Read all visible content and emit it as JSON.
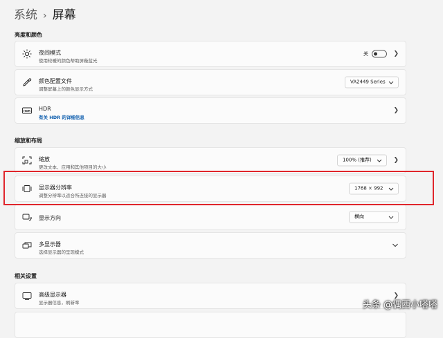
{
  "breadcrumb": {
    "parent": "系统",
    "separator": "›",
    "current": "屏幕"
  },
  "sections": {
    "brightness": "亮度和颜色",
    "scale_layout": "缩放和布局",
    "related": "相关设置"
  },
  "night_light": {
    "title": "夜间模式",
    "desc": "使用较暖的颜色帮助屏蔽蓝光",
    "toggle_label": "关",
    "state": "off",
    "icon": "sun-icon"
  },
  "color_profile": {
    "title": "颜色配置文件",
    "desc": "调整屏幕上的颜色显示方式",
    "value": "VA2449 Series",
    "icon": "eyedropper-icon"
  },
  "hdr": {
    "title": "HDR",
    "desc": "有关 HDR 的详细信息",
    "icon": "hdr-icon"
  },
  "scale": {
    "title": "缩放",
    "desc": "更改文本、应用和其他项目的大小",
    "value": "100% (推荐)",
    "icon": "scale-icon"
  },
  "resolution": {
    "title": "显示器分辨率",
    "desc": "调整分辨率以适合所连接的显示器",
    "value": "1768 × 992",
    "icon": "resolution-icon"
  },
  "orientation": {
    "title": "显示方向",
    "value": "横向",
    "icon": "orientation-icon"
  },
  "multi_display": {
    "title": "多显示器",
    "desc": "选择显示器的呈现模式",
    "icon": "multi-display-icon"
  },
  "advanced_display": {
    "title": "高级显示器",
    "desc": "显示器信息，刷新率",
    "icon": "monitor-icon"
  },
  "watermark": "头条 @偶西小嗒嗒",
  "colors": {
    "accent_link": "#0b5cad",
    "highlight": "#e0252b"
  }
}
